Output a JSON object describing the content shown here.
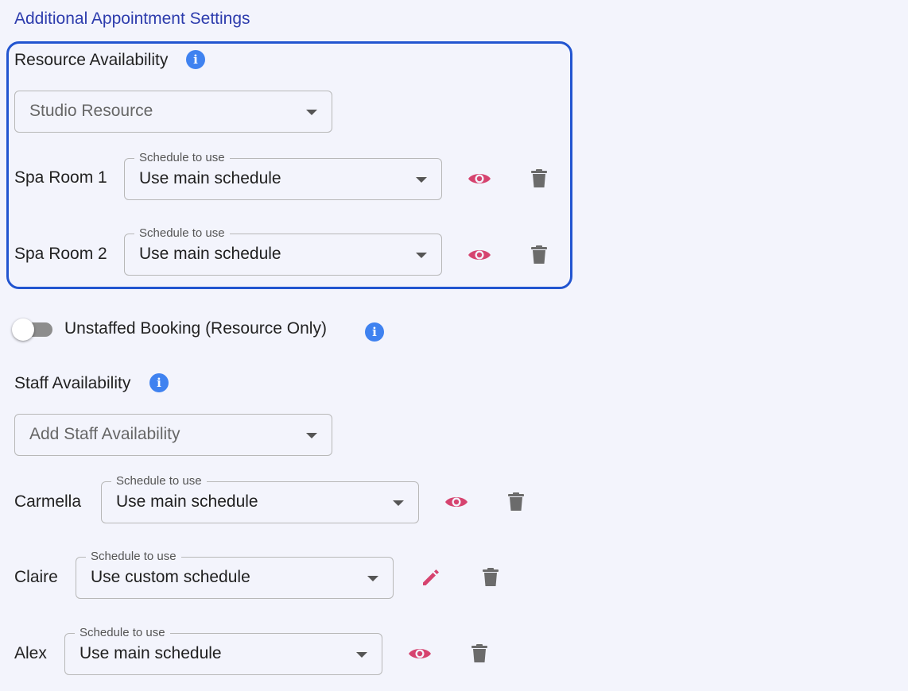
{
  "section_title": "Additional Appointment Settings",
  "resource": {
    "label": "Resource Availability",
    "select_value": "Studio Resource",
    "rows": [
      {
        "name": "Spa Room 1",
        "legend": "Schedule to use",
        "schedule": "Use main schedule",
        "action_icon": "eye-icon"
      },
      {
        "name": "Spa Room 2",
        "legend": "Schedule to use",
        "schedule": "Use main schedule",
        "action_icon": "eye-icon"
      }
    ]
  },
  "unstaffed": {
    "label": "Unstaffed Booking (Resource Only)",
    "enabled": false
  },
  "staff": {
    "label": "Staff Availability",
    "select_placeholder": "Add Staff Availability",
    "rows": [
      {
        "name": "Carmella",
        "legend": "Schedule to use",
        "schedule": "Use main schedule",
        "action_icon": "eye-icon"
      },
      {
        "name": "Claire",
        "legend": "Schedule to use",
        "schedule": "Use custom schedule",
        "action_icon": "pencil-icon"
      },
      {
        "name": "Alex",
        "legend": "Schedule to use",
        "schedule": "Use main schedule",
        "action_icon": "eye-icon"
      }
    ]
  },
  "colors": {
    "title": "#2d3cad",
    "highlight_border": "#2255d0",
    "info_icon": "#3f82f0",
    "action_icon": "#d6436f",
    "delete_icon": "#6b6b6b"
  }
}
